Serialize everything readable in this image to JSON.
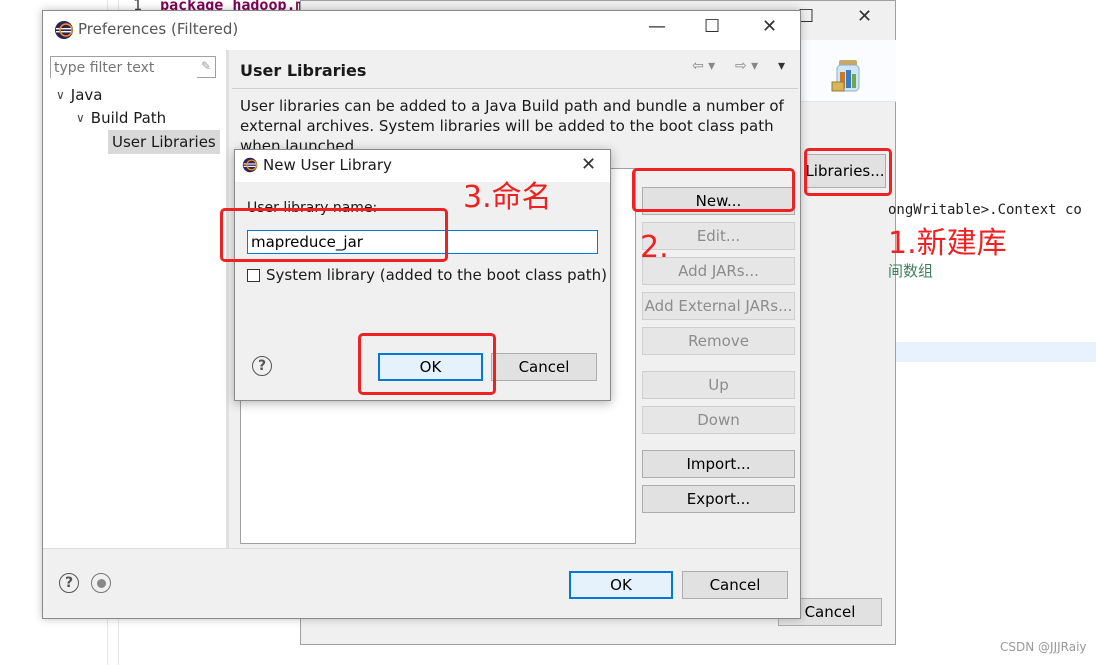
{
  "background": {
    "editor_line_no": "1",
    "editor_code_fragment": "package hadoop.m",
    "code_right": "ongWritable>.Context co",
    "code_right_chinese": "间数组",
    "back_libraries_label": "Libraries...",
    "back_cancel_label": "Cancel"
  },
  "preferences": {
    "title": "Preferences (Filtered)",
    "filter_placeholder": "type filter text",
    "tree": [
      {
        "label": "Java"
      },
      {
        "label": "Build Path"
      },
      {
        "label": "User Libraries"
      }
    ],
    "page_title": "User Libraries",
    "description": "User libraries can be added to a Java Build path and bundle a number of external archives. System libraries will be added to the boot class path when launched.",
    "buttons": {
      "new": "New...",
      "edit": "Edit...",
      "add_jars": "Add JARs...",
      "add_external_jars": "Add External JARs...",
      "remove": "Remove",
      "up": "Up",
      "down": "Down",
      "import": "Import...",
      "export": "Export..."
    },
    "ok_label": "OK",
    "cancel_label": "Cancel"
  },
  "new_library_dialog": {
    "title": "New User Library",
    "name_label": "User library name:",
    "name_value": "mapreduce_jar",
    "system_checkbox_label": "System library (added to the boot class path)",
    "ok_label": "OK",
    "cancel_label": "Cancel"
  },
  "annotations": {
    "step1": "1.新建库",
    "step2": "2.",
    "step3": "3.命名"
  },
  "watermark": "CSDN @JJJRaiy",
  "colors": {
    "annotation_red": "#ee2222",
    "focus_blue": "#0078d7"
  }
}
